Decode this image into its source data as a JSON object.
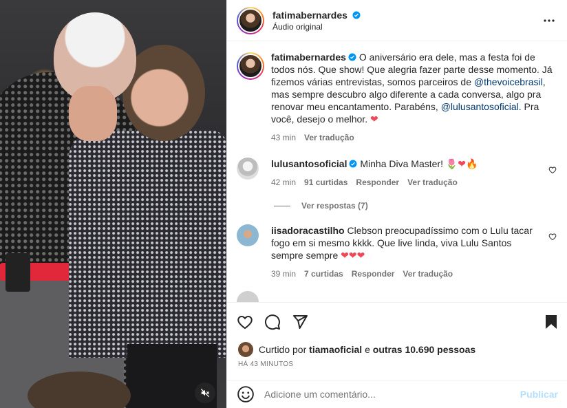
{
  "post": {
    "author": "fatimabernardes",
    "audio": "Áudio original"
  },
  "caption": {
    "username": "fatimabernardes",
    "text_1": " O aniversário era dele, mas a festa foi de todos nós. Que show! Que alegria fazer parte desse momento. Já fizemos várias entrevistas, somos parceiros de ",
    "mention_1": "@thevoicebrasil",
    "text_2": ", mas sempre descubro algo diferente a cada conversa, algo pra renovar meu encantamento. Parabéns, ",
    "mention_2": "@lulusantosoficial",
    "text_3": ". Pra você, desejo o melhor. ",
    "emoji": "❤",
    "time": "43 min",
    "translate": "Ver tradução"
  },
  "comments": [
    {
      "username": "lulusantosoficial",
      "text": "Minha Diva Master! ",
      "emoji": "🌷❤🔥",
      "time": "42 min",
      "likes": "91 curtidas",
      "reply": "Responder",
      "translate": "Ver tradução",
      "view_replies": "Ver respostas (7)"
    },
    {
      "username": "iisadoracastilho",
      "text": "Clebson preocupadíssimo com o Lulu tacar fogo em si mesmo kkkk. Que live linda, viva Lulu Santos sempre sempre ",
      "emoji": "❤❤❤",
      "time": "39 min",
      "likes": "7 curtidas",
      "reply": "Responder",
      "translate": "Ver tradução"
    }
  ],
  "likes": {
    "prefix": "Curtido por ",
    "user": "tiamaoficial",
    "middle": " e ",
    "others": "outras 10.690 pessoas"
  },
  "time_ago": "HÁ 43 MINUTOS",
  "add_comment": {
    "placeholder": "Adicione um comentário...",
    "publish": "Publicar"
  },
  "colors": {
    "accent": "#0095f6",
    "link": "#00376b",
    "heart": "#ed4956",
    "muted": "#737373"
  }
}
